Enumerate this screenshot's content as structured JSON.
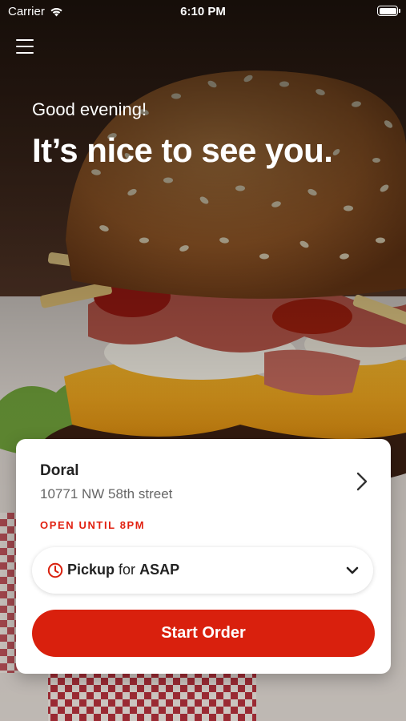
{
  "status_bar": {
    "carrier": "Carrier",
    "time": "6:10 PM",
    "wifi_icon": "wifi-icon",
    "battery_icon": "battery-icon"
  },
  "nav": {
    "menu_icon": "hamburger-menu-icon"
  },
  "hero": {
    "greeting": "Good evening!",
    "headline": "It’s nice to see you.",
    "image": "burger-photo"
  },
  "location_card": {
    "store_name": "Doral",
    "address": "10771 NW 58th street",
    "hours_status": "OPEN UNTIL 8PM",
    "chevron_icon": "chevron-right-icon"
  },
  "order_mode": {
    "icon": "clock-icon",
    "mode": "Pickup",
    "connector": "for",
    "timing": "ASAP",
    "dropdown_icon": "chevron-down-icon"
  },
  "cta": {
    "label": "Start Order"
  },
  "colors": {
    "accent_red": "#d9200d",
    "hours_red": "#e11f0f",
    "card_bg": "#ffffff",
    "text_dark": "#222222",
    "text_muted": "#666666"
  }
}
